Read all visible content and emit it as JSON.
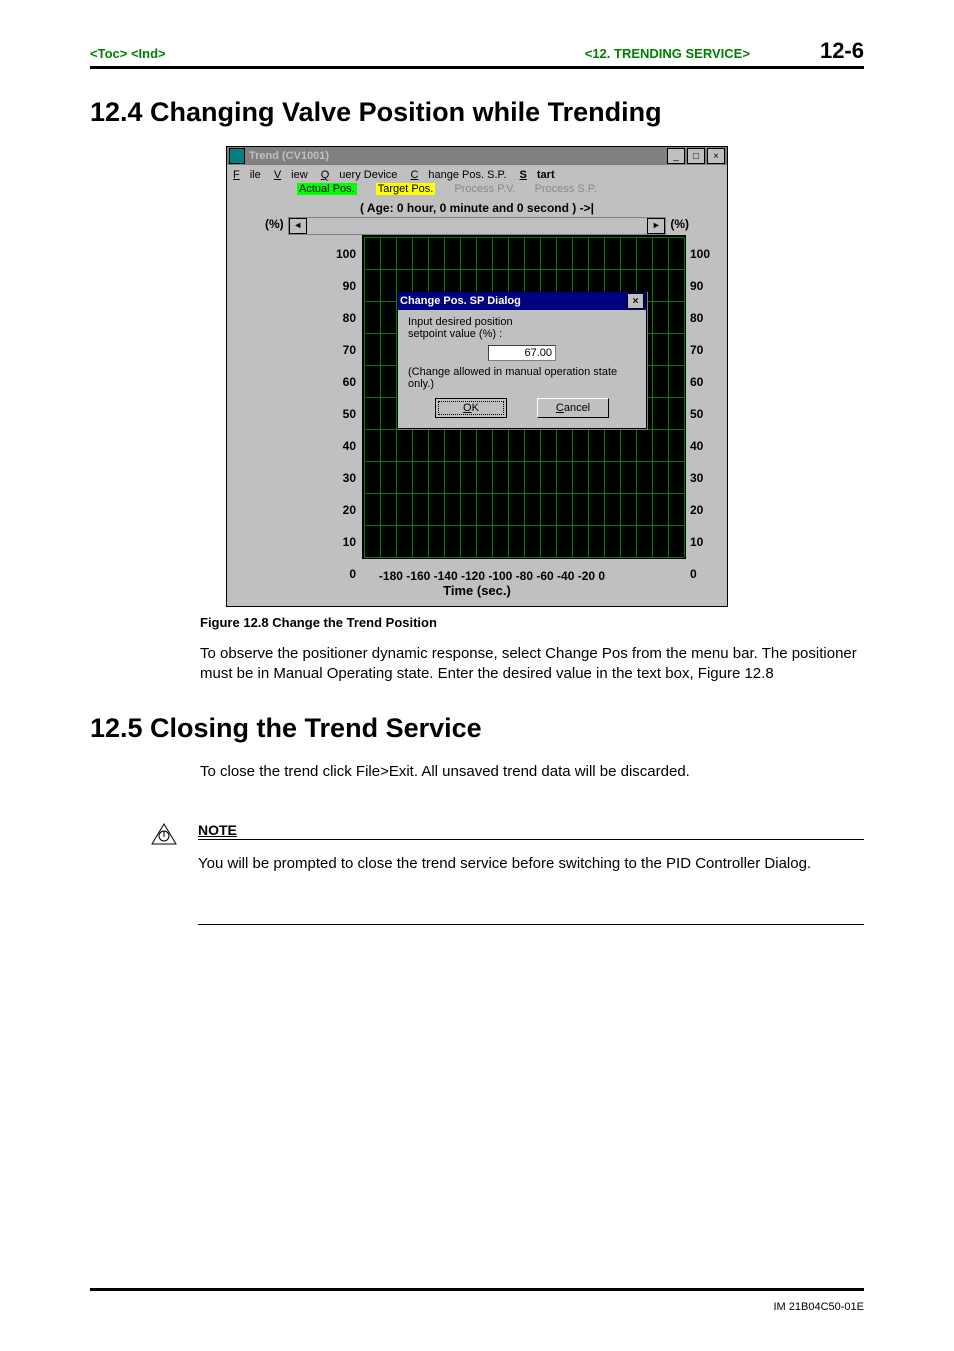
{
  "header": {
    "toc": "<Toc>",
    "ind": "<Ind>",
    "chapter": "<12. TRENDING SERVICE>",
    "page": "12-6"
  },
  "section_12_4": {
    "heading": "12.4  Changing Valve Position while Trending",
    "caption": "Figure 12.8  Change the Trend Position",
    "paragraph": "To observe the positioner dynamic response, select Change Pos from the menu bar.  The positioner must be in Manual Operating state.  Enter the desired value in the text box, Figure 12.8"
  },
  "section_12_5": {
    "heading": "12.5  Closing the Trend Service",
    "paragraph": "To close the trend click File>Exit.  All unsaved trend data will be discarded.",
    "note_label": "NOTE",
    "note_body": "You will be prompted to close the trend service before switching to the PID Controller Dialog."
  },
  "trend_window": {
    "title": "Trend (CV1001)",
    "menu": {
      "file": "File",
      "view": "View",
      "query": "Query Device",
      "change": "Change Pos. S.P.",
      "start": "Start"
    },
    "legend": {
      "actual": "Actual Pos.",
      "target": "Target Pos.",
      "pv": "Process P.V.",
      "sp": "Process S.P."
    },
    "age": "( Age:  0 hour, 0 minute and 0 second ) ->|",
    "y_unit": "(%)",
    "y_ticks": [
      "100",
      "90",
      "80",
      "70",
      "60",
      "50",
      "40",
      "30",
      "20",
      "10",
      "0"
    ],
    "x_ticks": "-180 -160 -140 -120 -100  -80   -60   -40   -20    0",
    "x_label": "Time (sec.)"
  },
  "dialog": {
    "title": "Change Pos. SP Dialog",
    "prompt1": "Input desired position",
    "prompt2": "setpoint value (%) :",
    "value": "67.00",
    "note": "(Change allowed in manual operation state only.)",
    "ok": "OK",
    "cancel": "Cancel"
  },
  "chart_data": {
    "type": "line",
    "title": "Trend (CV1001)",
    "xlabel": "Time (sec.)",
    "ylabel": "(%)",
    "x_range": [
      -180,
      0
    ],
    "y_range": [
      0,
      100
    ],
    "x_ticks": [
      -180,
      -160,
      -140,
      -120,
      -100,
      -80,
      -60,
      -40,
      -20,
      0
    ],
    "y_ticks": [
      0,
      10,
      20,
      30,
      40,
      50,
      60,
      70,
      80,
      90,
      100
    ],
    "series": [
      {
        "name": "Actual Pos.",
        "color": "#00ff00",
        "values": []
      },
      {
        "name": "Target Pos.",
        "color": "#ffff00",
        "values": []
      },
      {
        "name": "Process P.V.",
        "color": "#888888",
        "values": []
      },
      {
        "name": "Process S.P.",
        "color": "#888888",
        "values": []
      }
    ],
    "annotation": "No trend samples plotted (Age: 0 hour, 0 minute and 0 second)"
  },
  "footer": "IM 21B04C50-01E"
}
